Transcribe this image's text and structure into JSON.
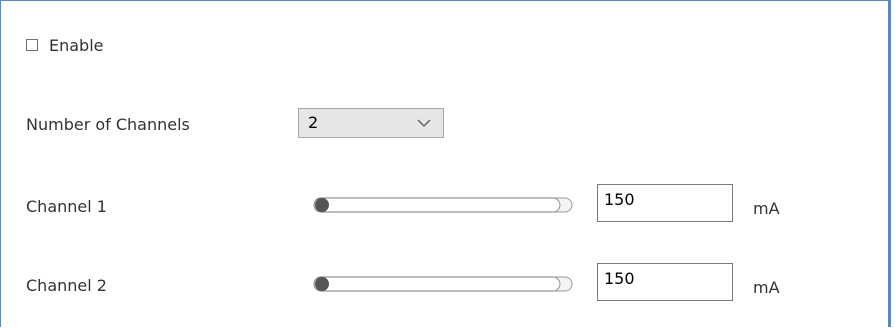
{
  "enable": {
    "label": "Enable",
    "checked": false
  },
  "channels_select": {
    "label": "Number of Channels",
    "value": "2",
    "icon": "chevron-down-icon"
  },
  "channels": [
    {
      "label": "Channel 1",
      "slider_fraction": 0.0,
      "value": "150",
      "unit": "mA"
    },
    {
      "label": "Channel 2",
      "slider_fraction": 0.0,
      "value": "150",
      "unit": "mA"
    }
  ],
  "colors": {
    "border": "#5b86c0",
    "select_bg": "#e6e6e6",
    "slider_knob": "#555555"
  }
}
